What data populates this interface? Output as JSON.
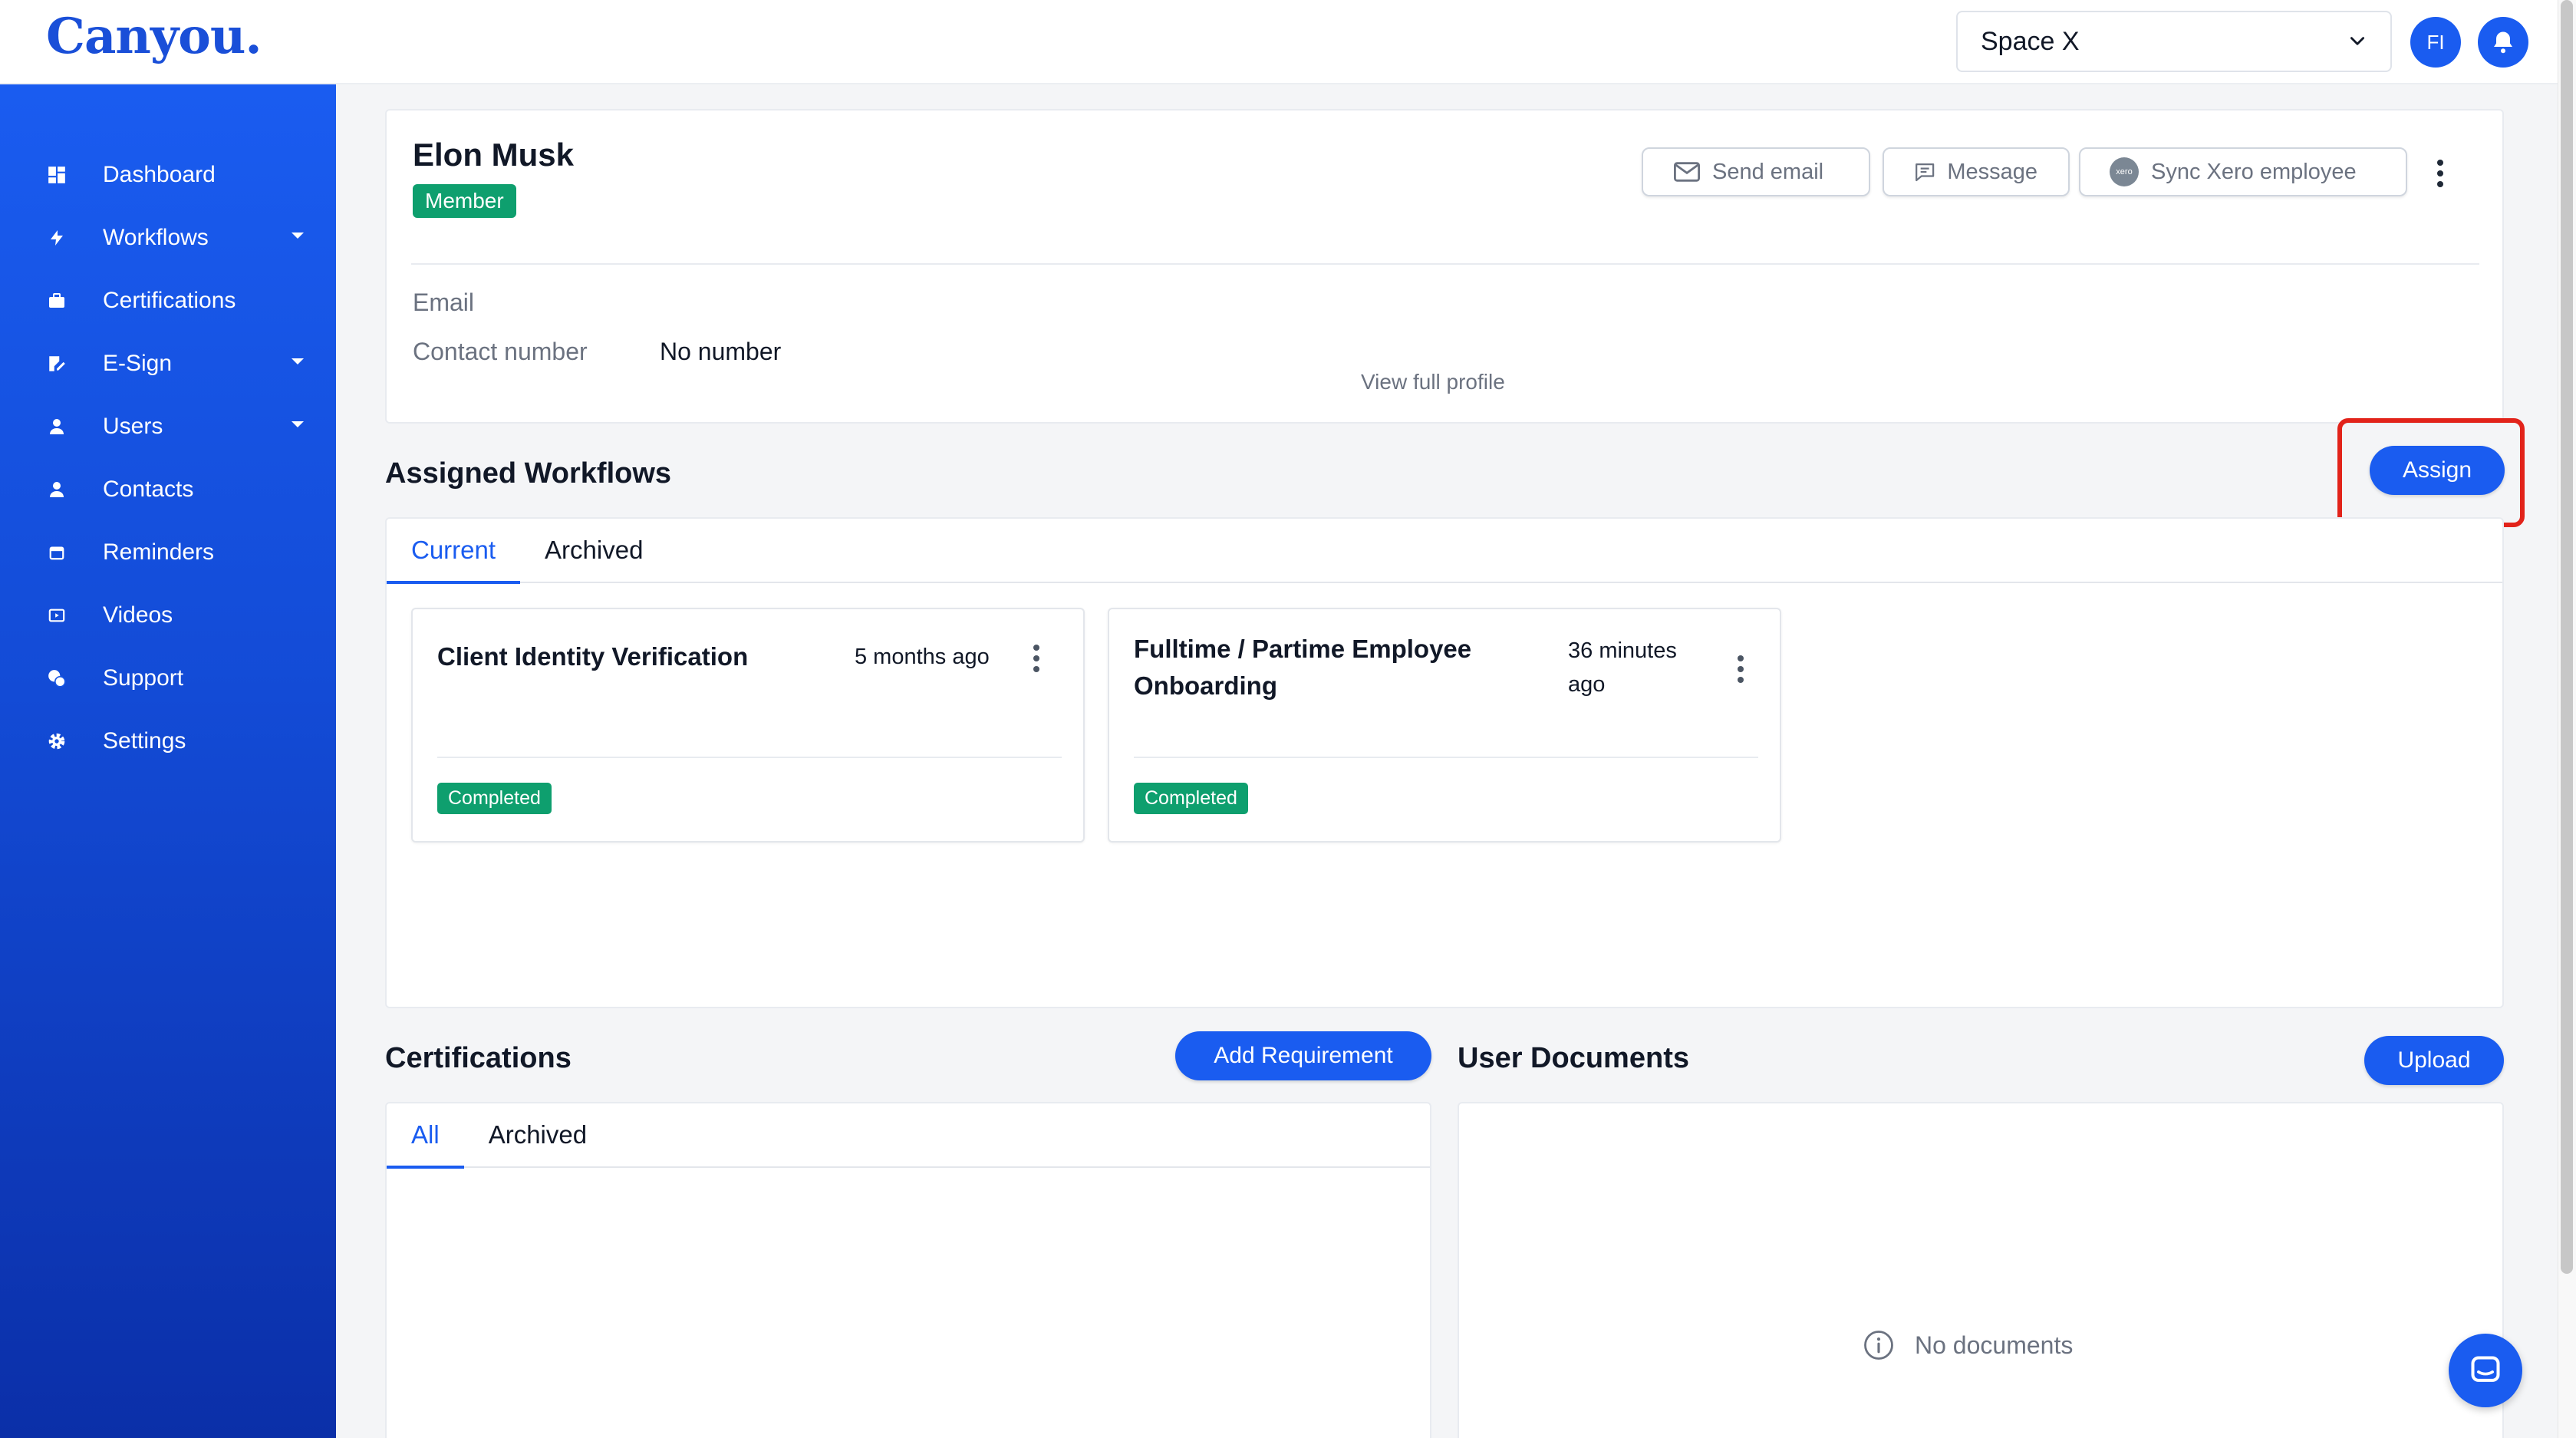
{
  "app": {
    "logo": "Canyou."
  },
  "header": {
    "space_selector": "Space X",
    "avatar_initials": "FI"
  },
  "sidebar": {
    "items": [
      {
        "label": "Dashboard",
        "icon": "dashboard-icon"
      },
      {
        "label": "Workflows",
        "icon": "lightning-icon",
        "expandable": true
      },
      {
        "label": "Certifications",
        "icon": "briefcase-icon"
      },
      {
        "label": "E-Sign",
        "icon": "signature-icon",
        "expandable": true
      },
      {
        "label": "Users",
        "icon": "user-icon",
        "expandable": true
      },
      {
        "label": "Contacts",
        "icon": "contact-icon"
      },
      {
        "label": "Reminders",
        "icon": "calendar-icon"
      },
      {
        "label": "Videos",
        "icon": "video-icon"
      },
      {
        "label": "Support",
        "icon": "support-icon"
      },
      {
        "label": "Settings",
        "icon": "gear-icon"
      }
    ]
  },
  "profile": {
    "name": "Elon Musk",
    "role_badge": "Member",
    "actions": {
      "send_email": "Send email",
      "message": "Message",
      "sync_xero": "Sync Xero employee",
      "xero_logo_text": "xero"
    },
    "email_label": "Email",
    "contact_label": "Contact number",
    "contact_value": "No number",
    "view_full_profile": "View full profile"
  },
  "assigned_workflows": {
    "title": "Assigned Workflows",
    "assign_button": "Assign",
    "tabs": [
      "Current",
      "Archived"
    ],
    "active_tab": "Current",
    "cards": [
      {
        "title": "Client Identity Verification",
        "time": "5 months ago",
        "status": "Completed"
      },
      {
        "title": "Fulltime / Partime Employee Onboarding",
        "time": "36 minutes ago",
        "status": "Completed"
      }
    ]
  },
  "certifications": {
    "title": "Certifications",
    "add_button": "Add Requirement",
    "tabs": [
      "All",
      "Archived"
    ],
    "active_tab": "All"
  },
  "user_documents": {
    "title": "User Documents",
    "upload_button": "Upload",
    "empty_text": "No documents"
  },
  "colors": {
    "primary": "#1a5cf0",
    "success": "#0e9f6e",
    "highlight": "#e2231a"
  }
}
